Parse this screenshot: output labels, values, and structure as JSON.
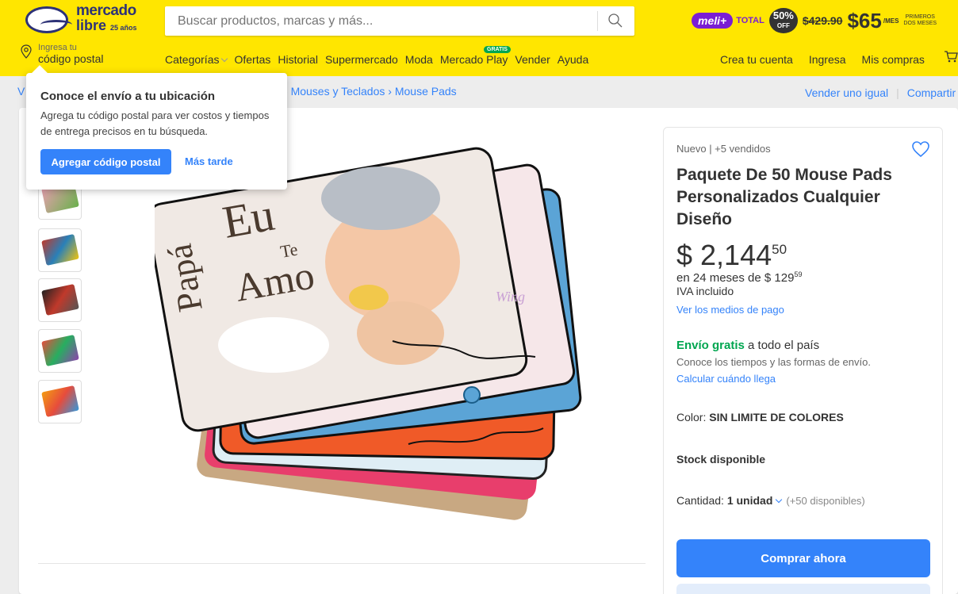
{
  "header": {
    "logo_line1": "mercado",
    "logo_line2": "libre",
    "logo_anniv": "25 años",
    "search_placeholder": "Buscar productos, marcas y más...",
    "promo": {
      "brand": "meli+",
      "total": "TOTAL",
      "off_pct": "50%",
      "off_word": "OFF",
      "old_price": "$429.90",
      "new_price": "$65",
      "per": "/MES",
      "note_line1": "PRIMEROS",
      "note_line2": "DOS MESES"
    },
    "postal_small": "Ingresa tu",
    "postal_main": "código postal",
    "nav": [
      "Categorías",
      "Ofertas",
      "Historial",
      "Supermercado",
      "Moda",
      "Mercado Play",
      "Vender",
      "Ayuda"
    ],
    "gratis_badge": "GRATIS",
    "user_nav": [
      "Crea tu cuenta",
      "Ingresa",
      "Mis compras"
    ]
  },
  "breadcrumb": {
    "start": "V",
    "items": [
      "Mouses y Teclados",
      "Mouse Pads"
    ],
    "actions": [
      "Vender uno igual",
      "Compartir"
    ]
  },
  "popup": {
    "title": "Conoce el envío a tu ubicación",
    "text": "Agrega tu código postal para ver costos y tiempos de entrega precisos en tu búsqueda.",
    "primary_button": "Agregar código postal",
    "secondary_link": "Más tarde"
  },
  "product": {
    "image_text": {
      "papa": "Papá",
      "eu": "Eu",
      "te": "Te",
      "amo": "Amo",
      "watermark": "Wing"
    },
    "condition": "Nuevo  |  +5 vendidos",
    "title": "Paquete De 50 Mouse Pads Personalizados Cualquier Diseño",
    "price_main": "$ 2,144",
    "price_cents": "50",
    "installments_prefix": "en 24 meses de $ 129",
    "installments_cents": "59",
    "iva": "IVA incluido",
    "payment_link": "Ver los medios de pago",
    "shipping_bold": "Envío gratis",
    "shipping_rest": " a todo el país",
    "shipping_sub": "Conoce los tiempos y las formas de envío.",
    "shipping_link": "Calcular cuándo llega",
    "color_label": "Color: ",
    "color_value": "SIN LIMITE DE COLORES",
    "stock": "Stock disponible",
    "qty_label": "Cantidad: ",
    "qty_value": "1 unidad",
    "qty_available": "(+50 disponibles)",
    "buy_button": "Comprar ahora"
  },
  "colors": {
    "brand_yellow": "#ffe600",
    "accent_blue": "#3483fa",
    "free_shipping_green": "#00a650"
  }
}
